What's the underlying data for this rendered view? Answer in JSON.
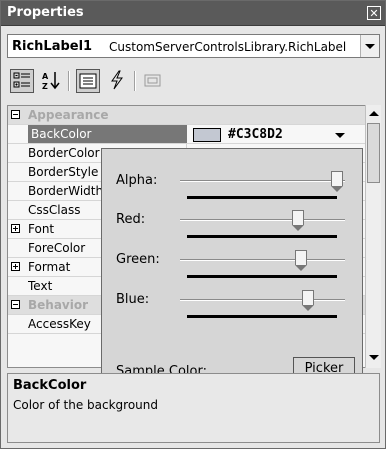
{
  "window": {
    "title": "Properties",
    "close_glyph": "✕"
  },
  "object_selector": {
    "name": "RichLabel1",
    "type": "CustomServerControlsLibrary.RichLabel"
  },
  "toolbar": {
    "buttons": [
      {
        "icon": "categorized-icon",
        "active": true
      },
      {
        "icon": "alphabetical-icon",
        "active": false
      },
      {
        "icon": "properties-icon",
        "active": true
      },
      {
        "icon": "events-icon",
        "active": false
      },
      {
        "icon": "property-pages-icon",
        "active": false
      }
    ]
  },
  "grid": {
    "rows": [
      {
        "kind": "category",
        "label": "Appearance",
        "expander": "minus"
      },
      {
        "kind": "property",
        "label": "BackColor",
        "selected": true,
        "value": "#C3C8D2"
      },
      {
        "kind": "property",
        "label": "BorderColor"
      },
      {
        "kind": "property",
        "label": "BorderStyle"
      },
      {
        "kind": "property",
        "label": "BorderWidth"
      },
      {
        "kind": "property",
        "label": "CssClass"
      },
      {
        "kind": "property",
        "label": "Font",
        "expander": "plus"
      },
      {
        "kind": "property",
        "label": "ForeColor"
      },
      {
        "kind": "property",
        "label": "Format",
        "expander": "plus"
      },
      {
        "kind": "property",
        "label": "Text"
      },
      {
        "kind": "category",
        "label": "Behavior",
        "expander": "minus"
      },
      {
        "kind": "property",
        "label": "AccessKey"
      }
    ]
  },
  "color_editor": {
    "sliders": [
      {
        "label": "Alpha:",
        "value": 255
      },
      {
        "label": "Red:",
        "value": 195
      },
      {
        "label": "Green:",
        "value": 200
      },
      {
        "label": "Blue:",
        "value": 210
      }
    ],
    "slider_max": 255,
    "sample_label": "Sample Color:",
    "picker_label": "Picker",
    "sample_color": "#C3C8D2"
  },
  "description": {
    "title": "BackColor",
    "text": "Color of the background"
  }
}
